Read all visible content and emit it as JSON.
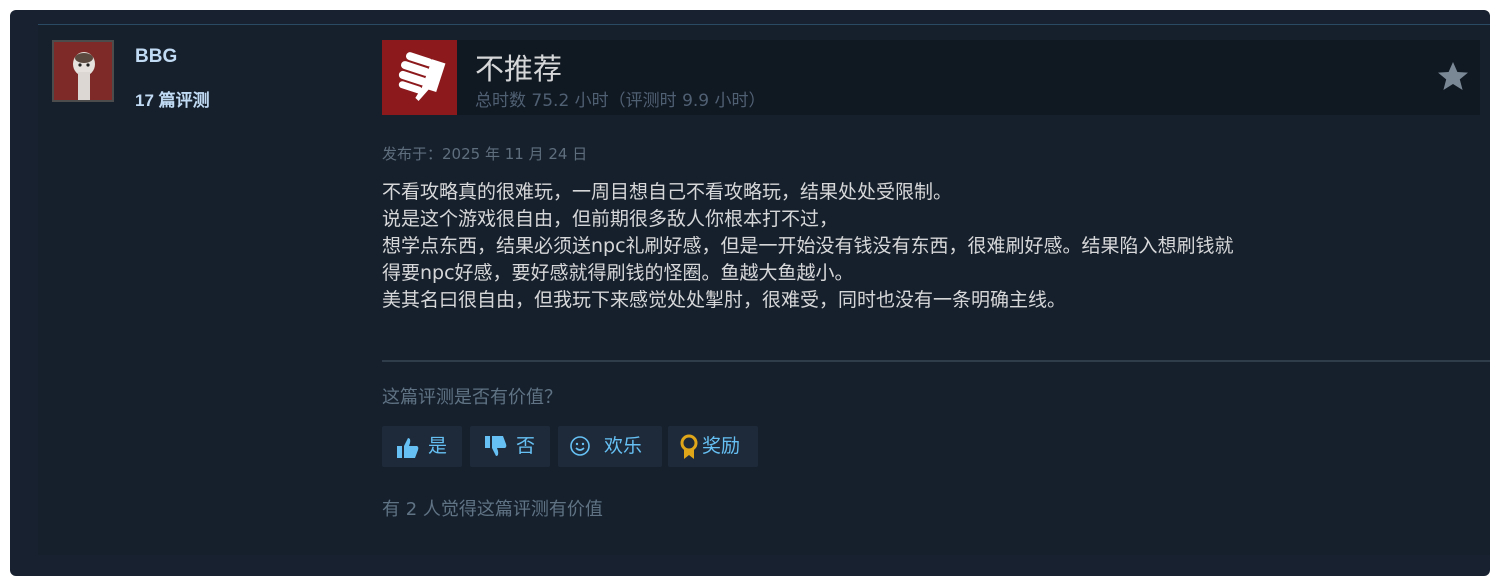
{
  "author": {
    "name": "BBG",
    "review_count": "17 篇评测"
  },
  "review": {
    "verdict": "不推荐",
    "hours": "总时数 75.2 小时（评测时 9.9 小时）",
    "posted": "发布于：2025 年 11 月 24 日",
    "body_lines": [
      "不看攻略真的很难玩，一周目想自己不看攻略玩，结果处处受限制。",
      "说是这个游戏很自由，但前期很多敌人你根本打不过，",
      "想学点东西，结果必须送npc礼刷好感，但是一开始没有钱没有东西，很难刷好感。结果陷入想刷钱就",
      "得要npc好感，要好感就得刷钱的怪圈。鱼越大鱼越小。",
      "美其名曰很自由，但我玩下来感觉处处掣肘，很难受，同时也没有一条明确主线。"
    ]
  },
  "feedback": {
    "question": "这篇评测是否有价值？",
    "yes_label": "是",
    "no_label": "否",
    "funny_label": "欢乐",
    "award_label": "奖励",
    "helpful_count": "有 2 人觉得这篇评测有价值"
  },
  "icons": {
    "thumb_down": "thumbs-down-icon",
    "star": "star-icon",
    "thumb_up_small": "thumbs-up-icon",
    "thumb_down_small": "thumbs-down-small-icon",
    "smile": "smile-icon",
    "award": "award-icon"
  },
  "colors": {
    "background": "#172130",
    "thumb_box": "#8c1a1d",
    "link_blue": "#66c0f4",
    "text": "#d6d7d8",
    "muted": "#5f7384",
    "award_gold": "#e0a619"
  }
}
